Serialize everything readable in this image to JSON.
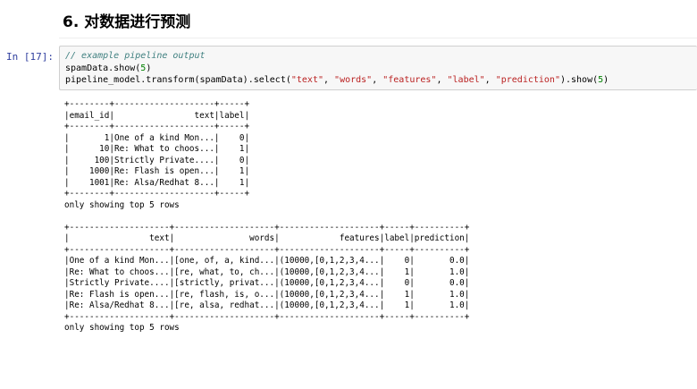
{
  "section": {
    "heading": "6. 对数据进行预测"
  },
  "cell": {
    "prompt": "In  [17]:",
    "code": {
      "comment": "// example pipeline output",
      "line2_pre": "spamData.show(",
      "line2_num": "5",
      "line2_post": ")",
      "line3_pre": "pipeline_model.transform(spamData).select(",
      "str_text": "\"text\"",
      "str_words": "\"words\"",
      "str_features": "\"features\"",
      "str_label": "\"label\"",
      "str_prediction": "\"prediction\"",
      "sep": ", ",
      "line3_mid": ").show(",
      "line3_num": "5",
      "line3_post": ")"
    },
    "output_text": "+--------+--------------------+-----+\n|email_id|                text|label|\n+--------+--------------------+-----+\n|       1|One of a kind Mon...|    0|\n|      10|Re: What to choos...|    1|\n|     100|Strictly Private....|    0|\n|    1000|Re: Flash is open...|    1|\n|    1001|Re: Alsa/Redhat 8...|    1|\n+--------+--------------------+-----+\nonly showing top 5 rows\n\n+--------------------+--------------------+--------------------+-----+----------+\n|                text|               words|            features|label|prediction|\n+--------------------+--------------------+--------------------+-----+----------+\n|One of a kind Mon...|[one, of, a, kind...|(10000,[0,1,2,3,4...|    0|       0.0|\n|Re: What to choos...|[re, what, to, ch...|(10000,[0,1,2,3,4...|    1|       1.0|\n|Strictly Private....|[strictly, privat...|(10000,[0,1,2,3,4...|    0|       0.0|\n|Re: Flash is open...|[re, flash, is, o...|(10000,[0,1,2,3,4...|    1|       1.0|\n|Re: Alsa/Redhat 8...|[re, alsa, redhat...|(10000,[0,1,2,3,4...|    1|       1.0|\n+--------------------+--------------------+--------------------+-----+----------+\nonly showing top 5 rows"
  }
}
